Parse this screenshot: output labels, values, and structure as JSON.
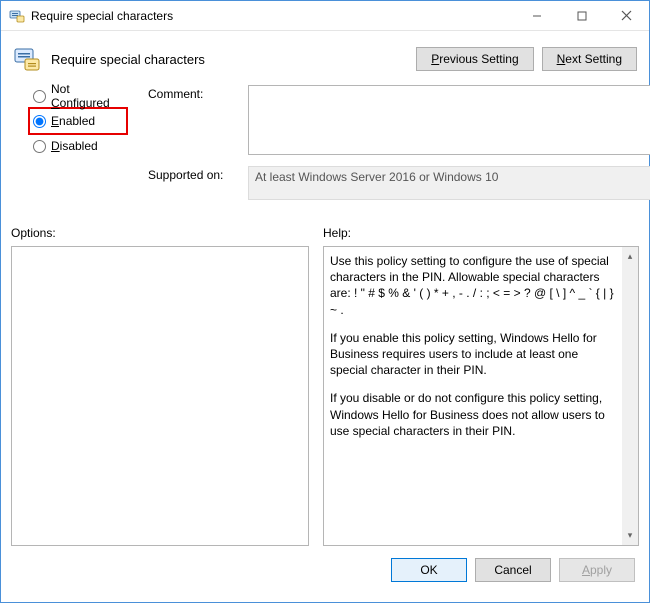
{
  "window": {
    "title": "Require special characters"
  },
  "header": {
    "title": "Require special characters",
    "previous_btn": "revious Setting",
    "previous_mn": "P",
    "next_btn": "ext Setting",
    "next_mn": "N"
  },
  "radios": {
    "not_configured_mn": "C",
    "not_configured_label": "onfigured",
    "not_configured_prefix": "Not ",
    "enabled_mn": "E",
    "enabled_label": "nabled",
    "disabled_mn": "D",
    "disabled_label": "isabled",
    "selected": "enabled"
  },
  "fields": {
    "comment_label": "Comment:",
    "comment_value": "",
    "supported_label": "Supported on:",
    "supported_value": "At least Windows Server 2016 or Windows 10"
  },
  "panels": {
    "options_label": "Options:",
    "help_label": "Help:"
  },
  "help": {
    "p1": "Use this policy setting to configure the use of special characters in the PIN.  Allowable special characters are: ! \" # $ % & ' ( ) * + , - . / : ; < = > ? @ [ \\ ] ^ _ ` { | } ~ .",
    "p2": "If you enable this policy setting, Windows Hello for Business requires users to include at least one special character in their PIN.",
    "p3": "If you disable or do not configure this policy setting, Windows Hello for Business does not allow users to use special characters in their PIN."
  },
  "footer": {
    "ok": "OK",
    "cancel": "Cancel",
    "apply_mn": "A",
    "apply": "pply"
  }
}
